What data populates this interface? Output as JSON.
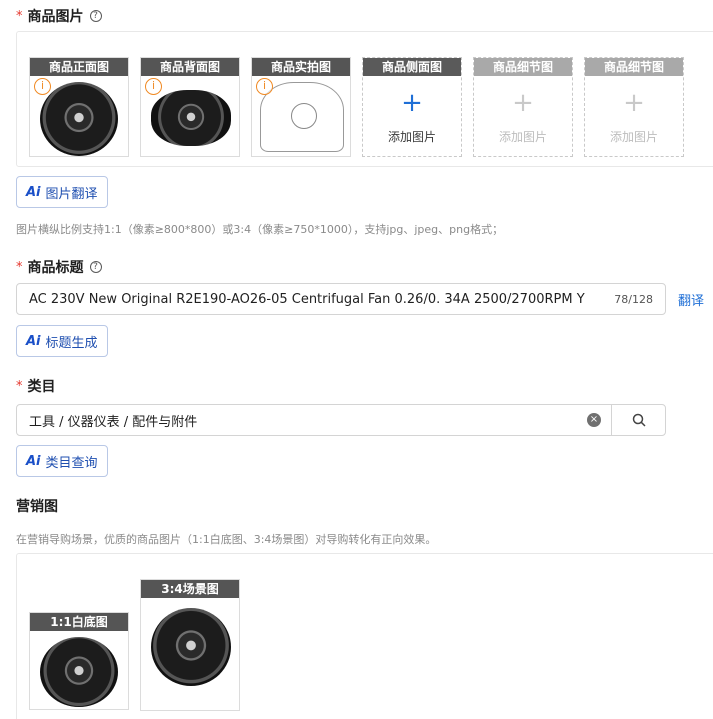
{
  "images_section": {
    "label": "商品图片",
    "help": "?",
    "slots": [
      {
        "tag": "商品正面图"
      },
      {
        "tag": "商品背面图"
      },
      {
        "tag": "商品实拍图"
      },
      {
        "tag": "商品侧面图",
        "add_label": "添加图片",
        "plus": "+"
      },
      {
        "tag": "商品细节图",
        "add_label": "添加图片",
        "plus": "+"
      },
      {
        "tag": "商品细节图",
        "add_label": "添加图片",
        "plus": "+"
      }
    ],
    "warn": "i",
    "translate_button": "图片翻译",
    "ai_badge": "Ai",
    "hint": "图片横纵比例支持1:1（像素≥800*800）或3:4（像素≥750*1000），支持jpg、jpeg、png格式；"
  },
  "title_section": {
    "label": "商品标题",
    "help": "?",
    "value": "AC 230V New Original R2E190-AO26-05 Centrifugal Fan 0.26/0. 34A 2500/2700RPM Y",
    "count": "78/128",
    "translate_link": "翻译",
    "generate_button": "标题生成",
    "ai_badge": "Ai"
  },
  "category_section": {
    "label": "类目",
    "value": "工具 / 仪器仪表 / 配件与附件",
    "clear": "×",
    "query_button": "类目查询",
    "ai_badge": "Ai"
  },
  "marketing_section": {
    "label": "营销图",
    "hint": "在营销导购场景，优质的商品图片（1:1白底图、3:4场景图）对导购转化有正向效果。",
    "slots": [
      {
        "tag": "1:1白底图"
      },
      {
        "tag": "3:4场景图"
      }
    ]
  },
  "required_mark": "*"
}
